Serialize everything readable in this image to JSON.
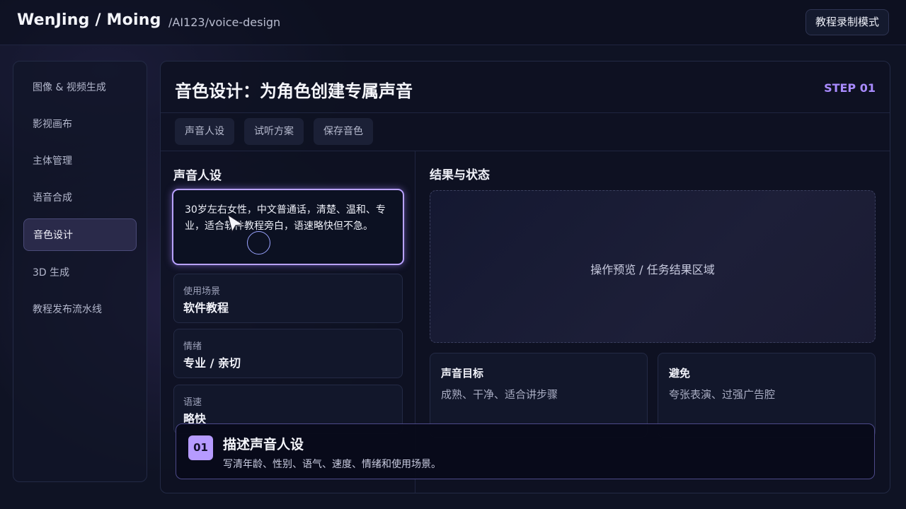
{
  "header": {
    "brand": "WenJing / Moing",
    "path": "/AI123/voice-design",
    "mode_button": "教程录制模式"
  },
  "sidebar": {
    "items": [
      {
        "label": "图像 & 视频生成"
      },
      {
        "label": "影视画布"
      },
      {
        "label": "主体管理"
      },
      {
        "label": "语音合成"
      },
      {
        "label": "音色设计",
        "active": true
      },
      {
        "label": "3D 生成"
      },
      {
        "label": "教程发布流水线"
      }
    ]
  },
  "main": {
    "title": "音色设计：为角色创建专属声音",
    "step": "STEP 01",
    "tabs": [
      {
        "label": "声音人设"
      },
      {
        "label": "试听方案"
      },
      {
        "label": "保存音色"
      }
    ],
    "persona": {
      "heading": "声音人设",
      "description": "30岁左右女性，中文普通话，清楚、温和、专业，适合软件教程旁白，语速略快但不急。",
      "fields": [
        {
          "label": "使用场景",
          "value": "软件教程"
        },
        {
          "label": "情绪",
          "value": "专业 / 亲切"
        },
        {
          "label": "语速",
          "value": "略快"
        }
      ]
    },
    "results": {
      "heading": "结果与状态",
      "preview_text": "操作预览 / 任务结果区域",
      "cards": [
        {
          "title": "声音目标",
          "text": "成熟、干净、适合讲步骤"
        },
        {
          "title": "避免",
          "text": "夸张表演、过强广告腔"
        }
      ]
    }
  },
  "caption": {
    "number": "01",
    "title": "描述声音人设",
    "subtitle": "写清年龄、性别、语气、速度、情绪和使用场景。"
  },
  "colors": {
    "accent": "#a98bff",
    "background": "#0f1324",
    "highlight_border": "#b9a2ff"
  }
}
